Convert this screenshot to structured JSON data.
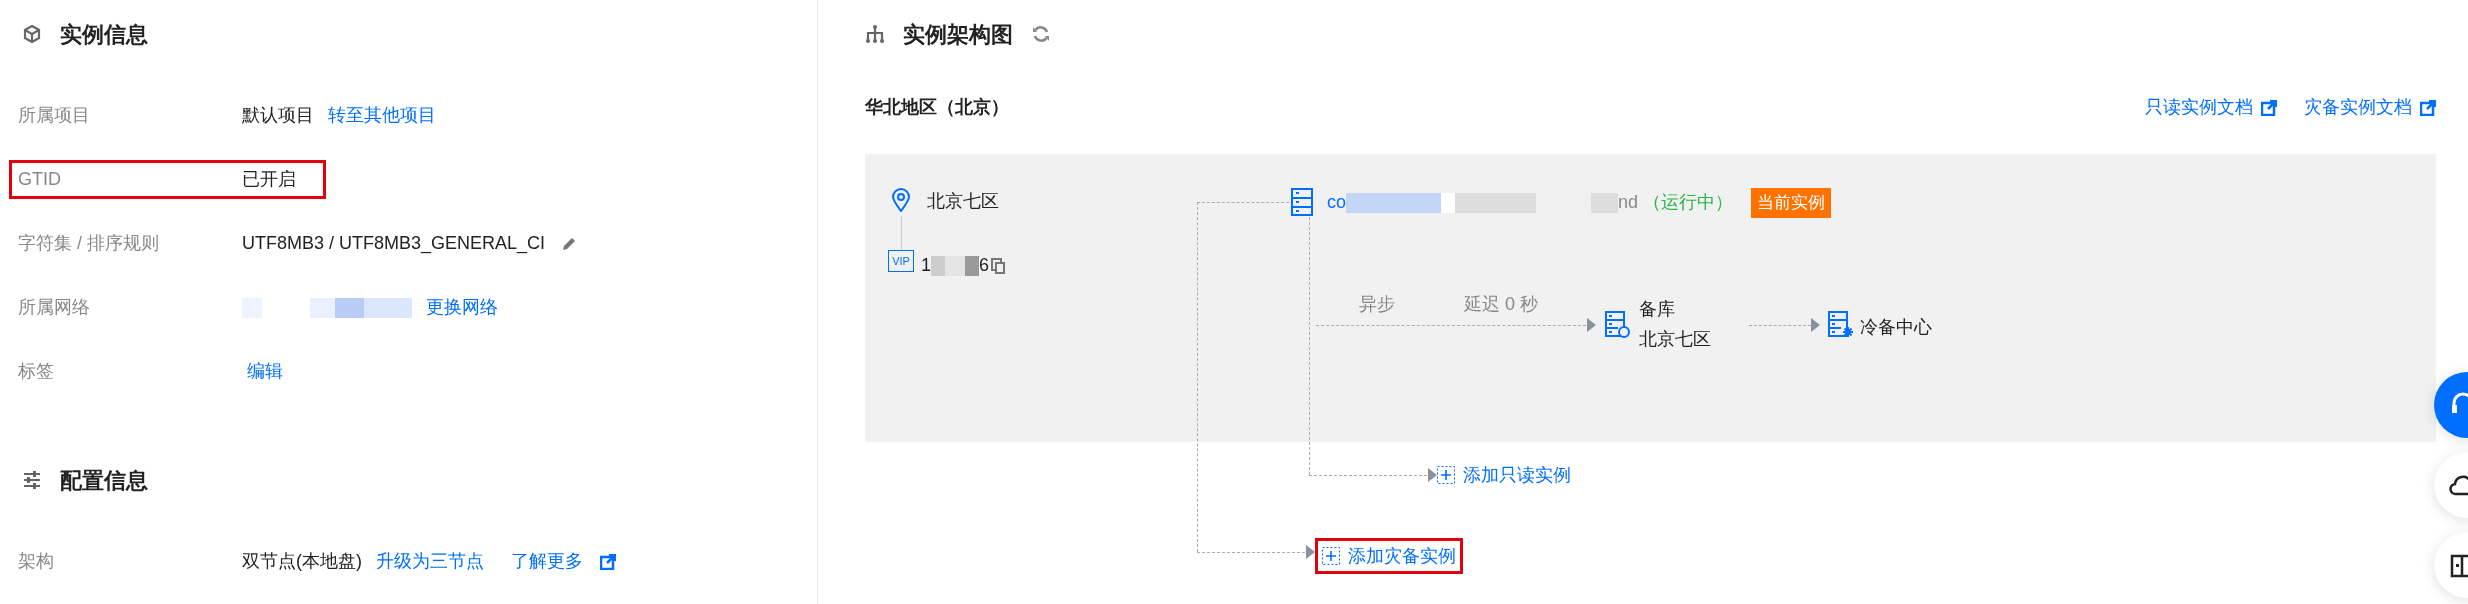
{
  "instance_info": {
    "title": "实例信息",
    "rows": [
      {
        "label": "所属项目",
        "value": "默认项目",
        "link": "转至其他项目",
        "highlighted": false
      },
      {
        "label": "GTID",
        "value": "已开启",
        "highlighted": true
      },
      {
        "label": "字符集 / 排序规则",
        "value": "UTF8MB3 / UTF8MB3_GENERAL_CI",
        "editable": true,
        "highlighted": false
      },
      {
        "label": "所属网络",
        "redacted": true,
        "link": "更换网络",
        "highlighted": false
      },
      {
        "label": "标签",
        "link": "编辑",
        "highlighted": false
      }
    ]
  },
  "config_info": {
    "title": "配置信息",
    "rows": [
      {
        "label": "架构",
        "value": "双节点(本地盘)",
        "link": "升级为三节点",
        "external_link": "了解更多",
        "highlighted": false
      }
    ]
  },
  "architecture": {
    "title": "实例架构图",
    "region": "华北地区（北京）",
    "doc_links": [
      "只读实例文档",
      "灾备实例文档"
    ],
    "zone": "北京七区",
    "vip": {
      "label": "VIP",
      "start": "1",
      "end": "6"
    },
    "instance": {
      "name_start": "co",
      "name_end": "nd",
      "status": "（运行中）",
      "badge": "当前实例"
    },
    "replication": {
      "mode": "异步",
      "delay": "延迟 0 秒"
    },
    "standby": {
      "role": "备库",
      "zone": "北京七区"
    },
    "cold_backup": "冷备中心",
    "add_readonly": {
      "label": "添加只读实例",
      "highlighted": false
    },
    "add_disaster": {
      "label": "添加灾备实例",
      "highlighted": true
    }
  },
  "floating_buttons": [
    {
      "kind": "support"
    },
    {
      "kind": "cloud"
    },
    {
      "kind": "docs"
    }
  ]
}
